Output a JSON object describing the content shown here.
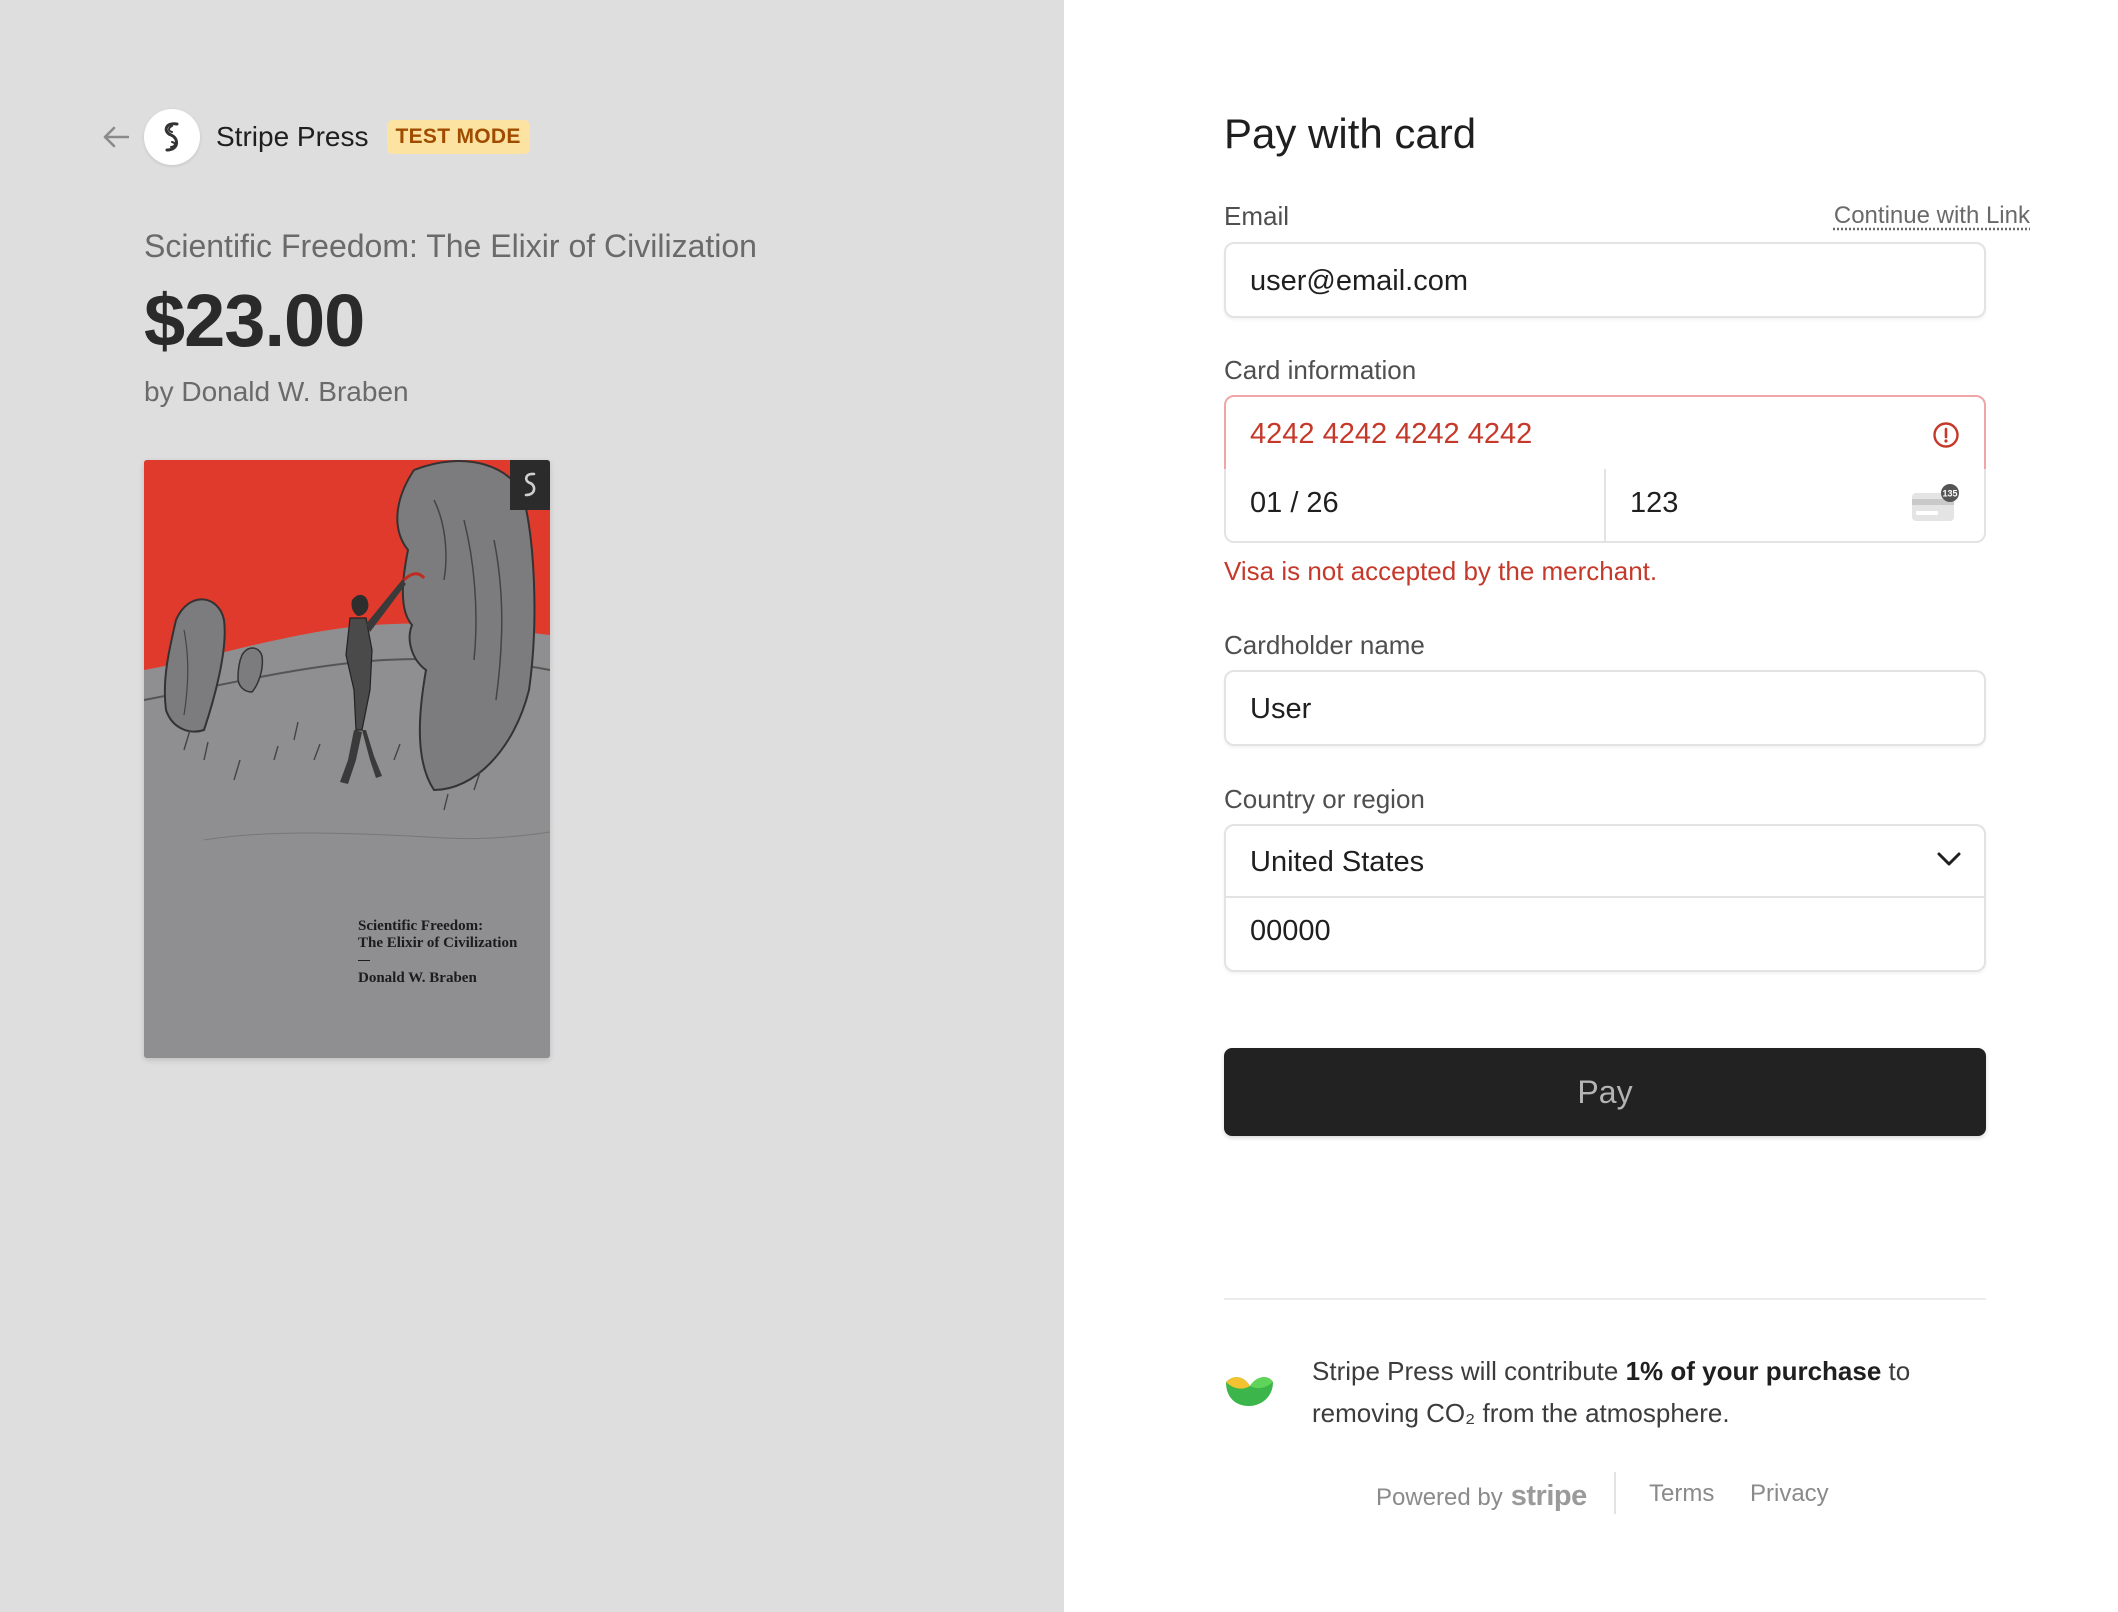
{
  "merchant": {
    "name": "Stripe Press",
    "badge": "TEST MODE"
  },
  "product": {
    "name": "Scientific Freedom: The Elixir of Civilization",
    "price": "$23.00",
    "author": "by Donald W. Braben",
    "cover": {
      "title_line1": "Scientific Freedom:",
      "title_line2": "The Elixir of Civilization",
      "author": "Donald W. Braben",
      "accent": "#e03a2c",
      "background": "#8f8f91"
    }
  },
  "form": {
    "title": "Pay with card",
    "email": {
      "label": "Email",
      "value": "user@email.com",
      "link": "Continue with Link"
    },
    "card": {
      "label": "Card information",
      "number": "4242 4242 4242 4242",
      "expiry": "01 / 26",
      "cvc": "123",
      "error": "Visa is not accepted by the merchant.",
      "error_color": "#c5392b"
    },
    "cardholder": {
      "label": "Cardholder name",
      "value": "User"
    },
    "country": {
      "label": "Country or region",
      "value": "United States",
      "zip": "00000"
    },
    "pay_button": "Pay"
  },
  "climate": {
    "text_before": "Stripe Press will contribute ",
    "text_bold": "1% of your purchase",
    "text_after": " to removing CO₂ from the atmosphere."
  },
  "footer": {
    "powered_by": "Powered by",
    "brand": "stripe",
    "terms": "Terms",
    "privacy": "Privacy"
  },
  "icons": {
    "back": "arrow-left-icon",
    "merchant_logo": "stripe-press-logo",
    "error": "error-circle-icon",
    "cvc": "cvc-card-icon",
    "dropdown": "chevron-down-icon",
    "climate": "climate-leaf-icon"
  }
}
